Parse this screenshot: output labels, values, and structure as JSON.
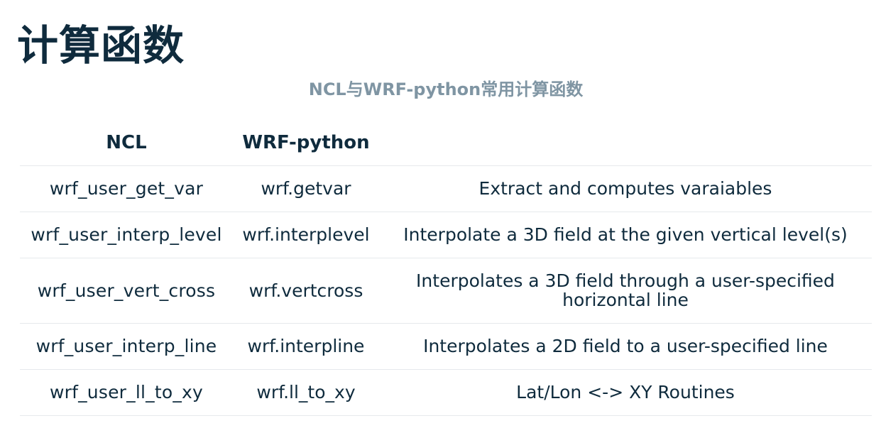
{
  "title": "计算函数",
  "caption": "NCL与WRF-python常用计算函数",
  "table": {
    "headers": [
      "NCL",
      "WRF-python",
      ""
    ],
    "rows": [
      {
        "ncl": "wrf_user_get_var",
        "wrf_python": "wrf.getvar",
        "description": "Extract and computes varaiables"
      },
      {
        "ncl": "wrf_user_interp_level",
        "wrf_python": "wrf.interplevel",
        "description": "Interpolate a 3D field at the given vertical level(s)"
      },
      {
        "ncl": "wrf_user_vert_cross",
        "wrf_python": "wrf.vertcross",
        "description": "Interpolates a 3D field through a user-specified horizontal line"
      },
      {
        "ncl": "wrf_user_interp_line",
        "wrf_python": "wrf.interpline",
        "description": "Interpolates a 2D field to a user-specified line"
      },
      {
        "ncl": "wrf_user_ll_to_xy",
        "wrf_python": "wrf.ll_to_xy",
        "description": "Lat/Lon <-> XY Routines"
      }
    ]
  },
  "colors": {
    "title": "#0f2b3d",
    "caption": "#7f95a3",
    "row_divider": "#e6e9ec"
  }
}
